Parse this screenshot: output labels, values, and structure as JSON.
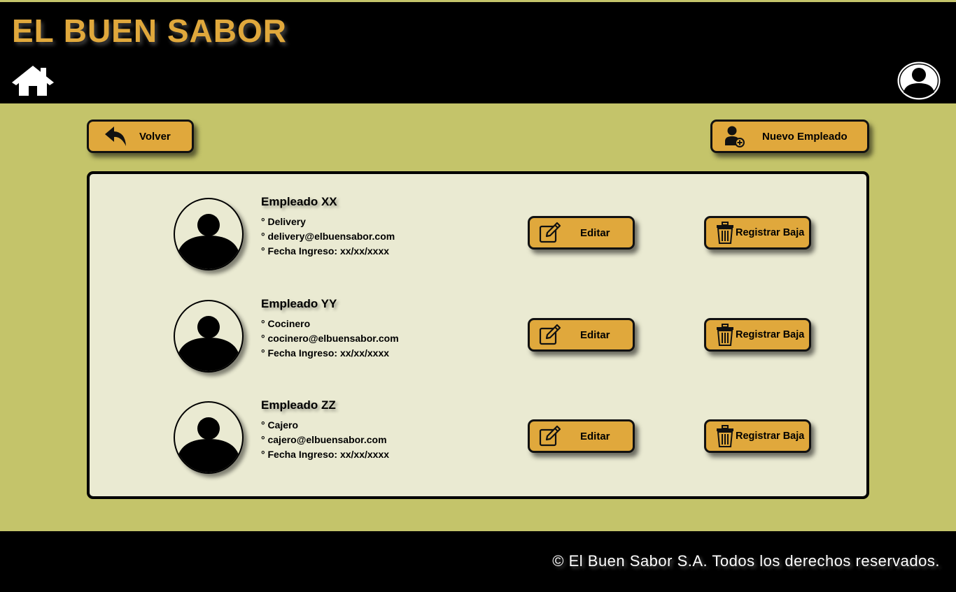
{
  "header": {
    "brand": "EL BUEN SABOR",
    "home_icon": "home-icon",
    "user_icon": "user-circle-icon"
  },
  "actions": {
    "back_label": "Volver",
    "new_employee_label": "Nuevo Empleado"
  },
  "employees": [
    {
      "name": "Empleado XX",
      "role": "° Delivery",
      "email": "° delivery@elbuensabor.com",
      "date": "° Fecha Ingreso: xx/xx/xxxx",
      "edit_label": "Editar",
      "remove_label": "Registrar Baja"
    },
    {
      "name": "Empleado YY",
      "role": "° Cocinero",
      "email": "° cocinero@elbuensabor.com",
      "date": "° Fecha Ingreso: xx/xx/xxxx",
      "edit_label": "Editar",
      "remove_label": "Registrar Baja"
    },
    {
      "name": "Empleado ZZ",
      "role": "° Cajero",
      "email": "° cajero@elbuensabor.com",
      "date": "° Fecha Ingreso: xx/xx/xxxx",
      "edit_label": "Editar",
      "remove_label": "Registrar Baja"
    }
  ],
  "footer": {
    "copyright": "© El Buen Sabor S.A. Todos los derechos reservados."
  },
  "colors": {
    "background": "#c4c46a",
    "bar": "#000000",
    "accent": "#e0a83c",
    "panel": "#eaead2"
  }
}
